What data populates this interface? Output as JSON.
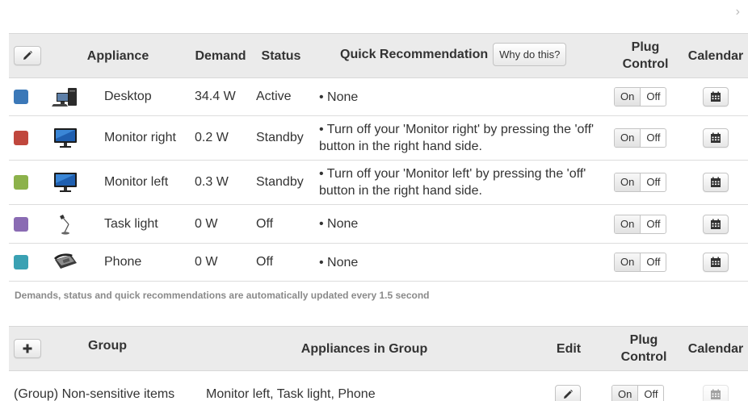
{
  "header": {
    "appliance": "Appliance",
    "demand": "Demand",
    "status": "Status",
    "quick_recommendation": "Quick Recommendation",
    "why_button": "Why do this?",
    "plug_control_line1": "Plug",
    "plug_control_line2": "Control",
    "calendar": "Calendar"
  },
  "appliances": [
    {
      "name": "Desktop",
      "demand": "34.4 W",
      "status": "Active",
      "recommendation": "• None",
      "color": "#3b78b8",
      "icon": "desktop-computer-icon"
    },
    {
      "name": "Monitor right",
      "demand": "0.2 W",
      "status": "Standby",
      "recommendation": "• Turn off your 'Monitor right' by pressing the 'off' button in the right hand side.",
      "color": "#c0473d",
      "icon": "monitor-icon"
    },
    {
      "name": "Monitor left",
      "demand": "0.3 W",
      "status": "Standby",
      "recommendation": "• Turn off your 'Monitor left' by pressing the 'off' button in the right hand side.",
      "color": "#8cb24b",
      "icon": "monitor-icon"
    },
    {
      "name": "Task light",
      "demand": "0 W",
      "status": "Off",
      "recommendation": "• None",
      "color": "#8a6bb3",
      "icon": "desk-lamp-icon"
    },
    {
      "name": "Phone",
      "demand": "0 W",
      "status": "Off",
      "recommendation": "• None",
      "color": "#3aa1b3",
      "icon": "phone-icon"
    }
  ],
  "toggle": {
    "on": "On",
    "off": "Off"
  },
  "note": "Demands, status and quick recommendations are automatically updated every 1.5 second",
  "group_header": {
    "group": "Group",
    "appliances_in_group": "Appliances in Group",
    "edit": "Edit",
    "plug_control_line1": "Plug",
    "plug_control_line2": "Control",
    "calendar": "Calendar"
  },
  "groups": [
    {
      "name": "(Group) Non-sensitive items",
      "appliances": "Monitor left, Task light, Phone"
    }
  ],
  "icons": {
    "close": "close-icon",
    "edit": "pencil-icon",
    "add": "plus-icon",
    "calendar": "calendar-icon"
  }
}
